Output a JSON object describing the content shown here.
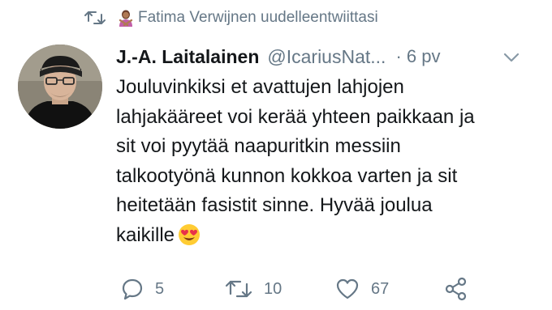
{
  "retweet_context": {
    "text": "Fatima Verwijnen uudelleentwiittasi",
    "icon": "retweet-icon",
    "emoji": "person-gesturing-no-emoji"
  },
  "tweet": {
    "author_name": "J.-A. Laitalainen",
    "author_handle": "@IcariusNat...",
    "timestamp": "· 6 pv",
    "menu_icon": "chevron-down-icon",
    "text_lines": [
      "Jouluvinkiksi et avattujen lahjojen",
      "lahjakääreet voi kerää yhteen paikkaan ja",
      "sit voi pyytää naapuritkin messiin",
      "talkootyönä kunnon kokkoa varten ja sit",
      "heitetään fasistit sinne. Hyvää joulua",
      "kaikille"
    ],
    "trailing_emoji": "smiling-face-with-heart-eyes-emoji"
  },
  "actions": {
    "reply": {
      "icon": "reply-icon",
      "count": "5"
    },
    "retweet": {
      "icon": "retweet-icon",
      "count": "10"
    },
    "like": {
      "icon": "heart-icon",
      "count": "67"
    },
    "share": {
      "icon": "share-icon",
      "count": ""
    }
  },
  "colors": {
    "text": "#14171a",
    "secondary": "#657786",
    "background": "#ffffff"
  }
}
